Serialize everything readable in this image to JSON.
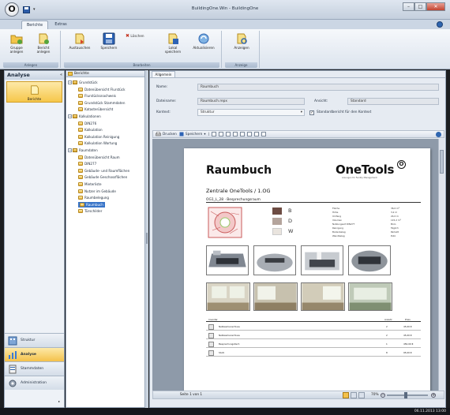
{
  "window": {
    "title": "BuildingOne.Win - BuildingOne",
    "logo_letter": "O"
  },
  "ribbon": {
    "tabs": [
      "Berichte",
      "Extras"
    ],
    "groups": [
      {
        "label": "Anlegen",
        "buttons": [
          {
            "line1": "Gruppe",
            "line2": "anlegen"
          },
          {
            "line1": "Bericht",
            "line2": "anlegen"
          }
        ]
      },
      {
        "label": "Bearbeiten",
        "buttons": [
          {
            "line1": "Austauschen",
            "line2": ""
          },
          {
            "line1": "Speichern",
            "line2": ""
          },
          {
            "line1": "Löschen",
            "line2": ""
          },
          {
            "line1": "Lokal",
            "line2": "speichern"
          },
          {
            "line1": "Aktualisieren",
            "line2": ""
          }
        ]
      },
      {
        "label": "Anzeige",
        "buttons": [
          {
            "line1": "Anzeigen",
            "line2": ""
          }
        ]
      }
    ]
  },
  "left_panel": {
    "header": "Analyse",
    "collapse_glyph": "«",
    "active_item": "Berichte",
    "nav": [
      "Struktur",
      "Analyse",
      "Stammdaten",
      "Administration"
    ]
  },
  "tree": {
    "header": "Berichte",
    "nodes": [
      {
        "level": 1,
        "label": "Grundstück",
        "open": true
      },
      {
        "level": 2,
        "label": "Datenübersicht Flurstück"
      },
      {
        "level": 2,
        "label": "Flurstücksnachweis"
      },
      {
        "level": 2,
        "label": "Grundstück Stammdaten"
      },
      {
        "level": 2,
        "label": "Katasterübersicht"
      },
      {
        "level": 1,
        "label": "Kalkulationen",
        "open": true
      },
      {
        "level": 2,
        "label": "DIN276"
      },
      {
        "level": 2,
        "label": "Kalkulation"
      },
      {
        "level": 2,
        "label": "Kalkulation Reinigung"
      },
      {
        "level": 2,
        "label": "Kalkulation Wartung"
      },
      {
        "level": 1,
        "label": "Raumdaten",
        "open": true
      },
      {
        "level": 2,
        "label": "Datenübersicht Raum"
      },
      {
        "level": 2,
        "label": "DIN277"
      },
      {
        "level": 2,
        "label": "Gebäude- und Raumflächen"
      },
      {
        "level": 2,
        "label": "Gebäude Geschossflächen"
      },
      {
        "level": 2,
        "label": "Mieterliste"
      },
      {
        "level": 2,
        "label": "Nutzer im Gebäude"
      },
      {
        "level": 2,
        "label": "Raumbelegung"
      },
      {
        "level": 2,
        "label": "Raumbuch",
        "selected": true
      },
      {
        "level": 2,
        "label": "Türschilder"
      }
    ]
  },
  "form": {
    "tab": "Allgemein",
    "name_label": "Name:",
    "name_value": "Raumbuch",
    "datei_label": "Dateiname:",
    "datei_value": "Raumbuch.repx",
    "ansicht_label": "Ansicht:",
    "ansicht_value": "Standard",
    "kontext_label": "Kontext:",
    "kontext_value": "Struktur",
    "standard_check_label": "Standardbericht für den Kontext",
    "standard_checked": true
  },
  "viewer_toolbar": {
    "print_label": "Drucken",
    "save_label": "Speichern"
  },
  "report": {
    "title": "Raumbuch",
    "logo": "OneTools",
    "tagline": "Lösungen für Facility Management",
    "subtitle": "Zentrale OneTools / 1.OG",
    "room_header": "OG1_L_28 · Besprechungsraum",
    "legend": [
      {
        "letter": "B",
        "color": "#6d4c43"
      },
      {
        "letter": "D",
        "color": "#b4a49c"
      },
      {
        "letter": "W",
        "color": "#e9e4de"
      }
    ],
    "props": [
      {
        "k": "Fläche",
        "v": "36,0 m²"
      },
      {
        "k": "Höhe",
        "v": "3,2 m"
      },
      {
        "k": "Umfang",
        "v": "24,0 m"
      },
      {
        "k": "Volumen",
        "v": "115,2 m³"
      },
      {
        "k": "Nutzungsart DIN277",
        "v": "Büro"
      },
      {
        "k": "Reinigung",
        "v": "Täglich"
      },
      {
        "k": "Bodenbelag",
        "v": "Parkett"
      },
      {
        "k": "Wandbelag",
        "v": "Putz"
      }
    ],
    "table_header": [
      "Inventar",
      "Anzahl",
      "Preis"
    ],
    "rows": [
      {
        "name": "Netzwerkanschluss",
        "amount": "2",
        "price": "45,00 €"
      },
      {
        "name": "Netzwerkanschluss",
        "amount": "2",
        "price": "45,00 €"
      },
      {
        "name": "Besprechungstisch",
        "amount": "1",
        "price": "450,00 €"
      },
      {
        "name": "Stuhl",
        "amount": "8",
        "price": "95,00 €"
      }
    ]
  },
  "status": {
    "page": "Seite 1 von 1",
    "zoom": "70%"
  },
  "taskbar": {
    "clock": "06.11.2013 13:00"
  }
}
